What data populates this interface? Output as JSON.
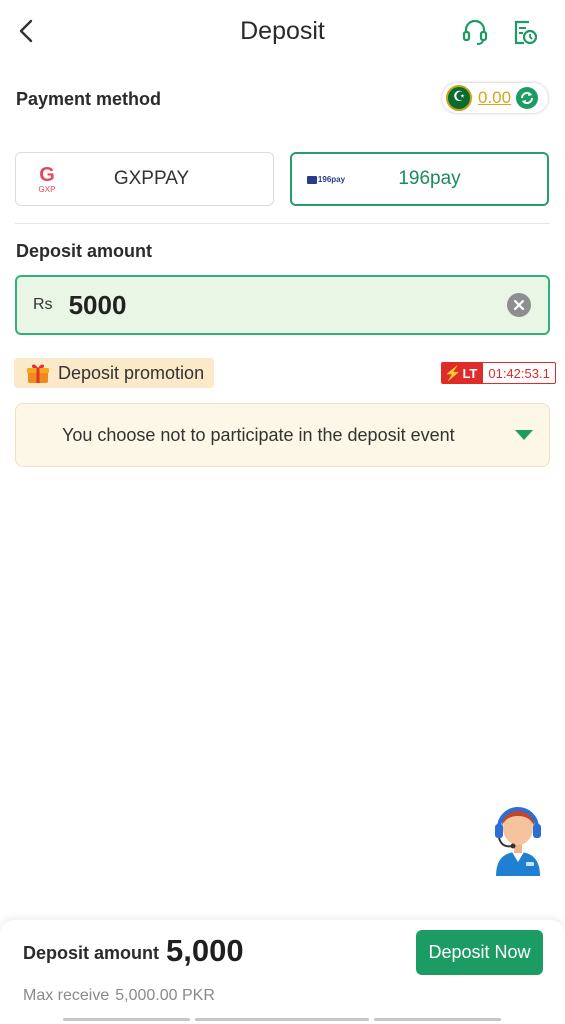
{
  "header": {
    "title": "Deposit"
  },
  "payment_method": {
    "label": "Payment method",
    "balance": "0.00",
    "methods": [
      {
        "name": "GXPPAY",
        "logo_text": "G",
        "logo_sub": "GXP",
        "selected": false
      },
      {
        "name": "196pay",
        "logo_text": "196pay",
        "selected": true
      }
    ]
  },
  "deposit_amount": {
    "label": "Deposit amount",
    "currency": "Rs",
    "value": "5000"
  },
  "promotion": {
    "tag": "Deposit promotion",
    "timer_badge": "LT",
    "timer": "01:42:53.1",
    "selection": "You choose not to participate in the deposit event"
  },
  "bottom": {
    "label": "Deposit amount",
    "amount": "5,000",
    "max_receive_label": "Max receive",
    "max_receive_value": "5,000.00 PKR",
    "button": "Deposit Now"
  },
  "colors": {
    "accent": "#1c9c63",
    "gold": "#d9a520",
    "alert": "#e02b2b"
  }
}
